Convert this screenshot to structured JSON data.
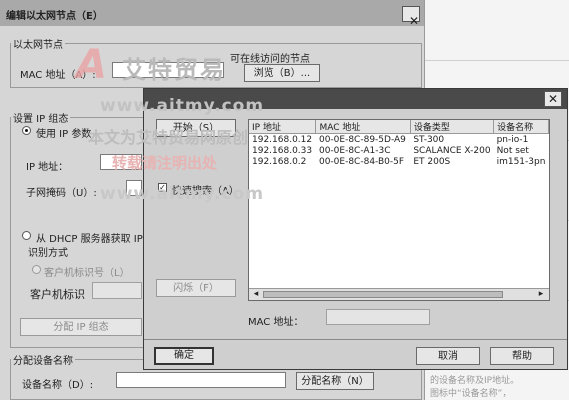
{
  "outer_dialog": {
    "title": "编辑以太网节点（E）",
    "close_glyph": "✕",
    "ethernet_group": {
      "legend": "以太网节点",
      "mac_label": "MAC 地址（A）:",
      "accessible_label": "可在线访问的节点",
      "browse_label": "浏览（B）..."
    },
    "ip_group": {
      "legend": "设置 IP 组态",
      "use_ip_label": "使用 IP 参数",
      "ip_label": "IP 地址：",
      "subnet_label": "子网掩码（U）:",
      "dhcp_label": "从 DHCP 服务器获取 IP",
      "ident_label": "识别方式",
      "client_id_radio": "客户机标识号（L）",
      "client_id_label": "客户机标识",
      "assign_ip_button": "分配 IP 组态"
    },
    "name_group": {
      "legend": "分配设备名称",
      "device_name_label": "设备名称（D）:",
      "assign_name_button": "分配名称（N）"
    }
  },
  "inner_dialog": {
    "close_glyph": "✕",
    "start_button": "开始（S）",
    "fast_search_label": "快速搜索（A）",
    "flash_button": "闪烁（F）",
    "columns": [
      "IP 地址",
      "MAC 地址",
      "设备类型",
      "设备名称"
    ],
    "rows": [
      [
        "192.168.0.12",
        "00-0E-8C-89-5D-A9",
        "ST-300",
        "pn-io-1"
      ],
      [
        "192.168.0.33",
        "00-0E-8C-A1-3C",
        "SCALANCE X-200",
        "Not set"
      ],
      [
        "192.168.0.2",
        "00-0E-8C-84-B0-5F",
        "ET 200S",
        "im151-3pn"
      ]
    ],
    "scroll_left": "◂",
    "scroll_right": "▸",
    "mac_label": "MAC 地址：",
    "ok_button": "确定",
    "cancel_button": "取消",
    "help_button": "帮助"
  },
  "watermark": {
    "logo_letter": "A",
    "brand": "艾特贸易",
    "url1": "www.aitmy.com",
    "line1": "本文为艾特贸易网原创",
    "line2": "转载请注明出处",
    "url2": "www.aitmy.com"
  },
  "background_doc": {
    "lines": [
      "的设备名称及IP地址。",
      "图标中“设备名称”，",
      "选择“分配设备名称”"
    ]
  }
}
